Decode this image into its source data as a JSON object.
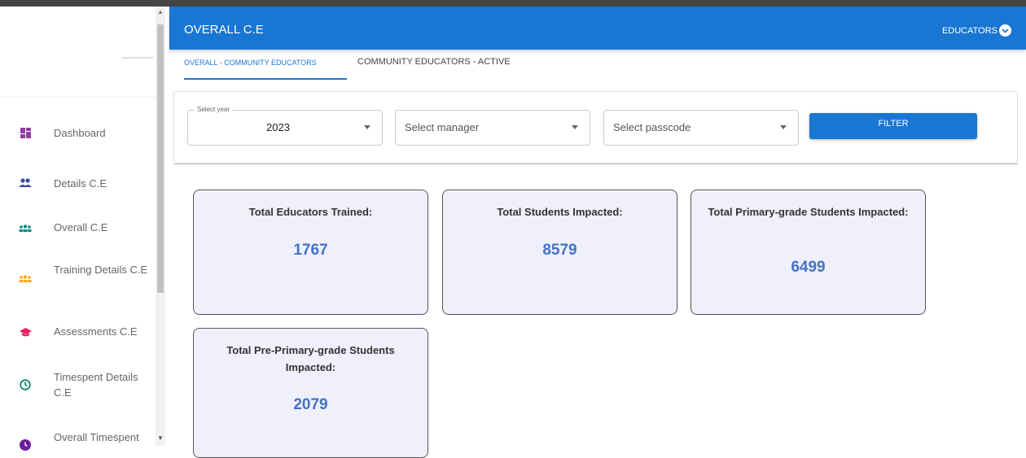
{
  "sidebar": {
    "items": [
      {
        "label": "Dashboard",
        "icon": "dashboard-icon",
        "color": "#8e3fa0"
      },
      {
        "label": "Details C.E",
        "icon": "people-icon",
        "color": "#3949ab"
      },
      {
        "label": "Overall C.E",
        "icon": "groups-icon",
        "color": "#00897b"
      },
      {
        "label": "Training Details C.E",
        "icon": "groups-icon",
        "color": "#f9a825"
      },
      {
        "label": "Assessments C.E",
        "icon": "graduation-cap-icon",
        "color": "#e91e63"
      },
      {
        "label": "Timespent Details C.E",
        "icon": "clock-icon",
        "color": "#00796b"
      },
      {
        "label": "Overall Timespent",
        "icon": "clock-icon",
        "color": "#6a1b9a"
      }
    ]
  },
  "header": {
    "title": "OVERALL C.E",
    "role_menu": "EDUCATORS",
    "color": "#1976d2"
  },
  "tabs": [
    {
      "label": "OVERALL - COMMUNITY EDUCATORS",
      "active": true
    },
    {
      "label": "COMMUNITY EDUCATORS - ACTIVE",
      "active": false
    }
  ],
  "filters": {
    "year": {
      "label": "Select year",
      "value": "2023"
    },
    "manager": {
      "placeholder": "Select manager"
    },
    "passcode": {
      "placeholder": "Select passcode"
    },
    "button_label": "FILTER"
  },
  "stats": [
    {
      "title": "Total Educators Trained:",
      "value": "1767"
    },
    {
      "title": "Total Students Impacted:",
      "value": "8579"
    },
    {
      "title": "Total Primary-grade Students Impacted:",
      "value": "6499"
    },
    {
      "title": "Total Pre-Primary-grade Students Impacted:",
      "value": "2079"
    }
  ]
}
